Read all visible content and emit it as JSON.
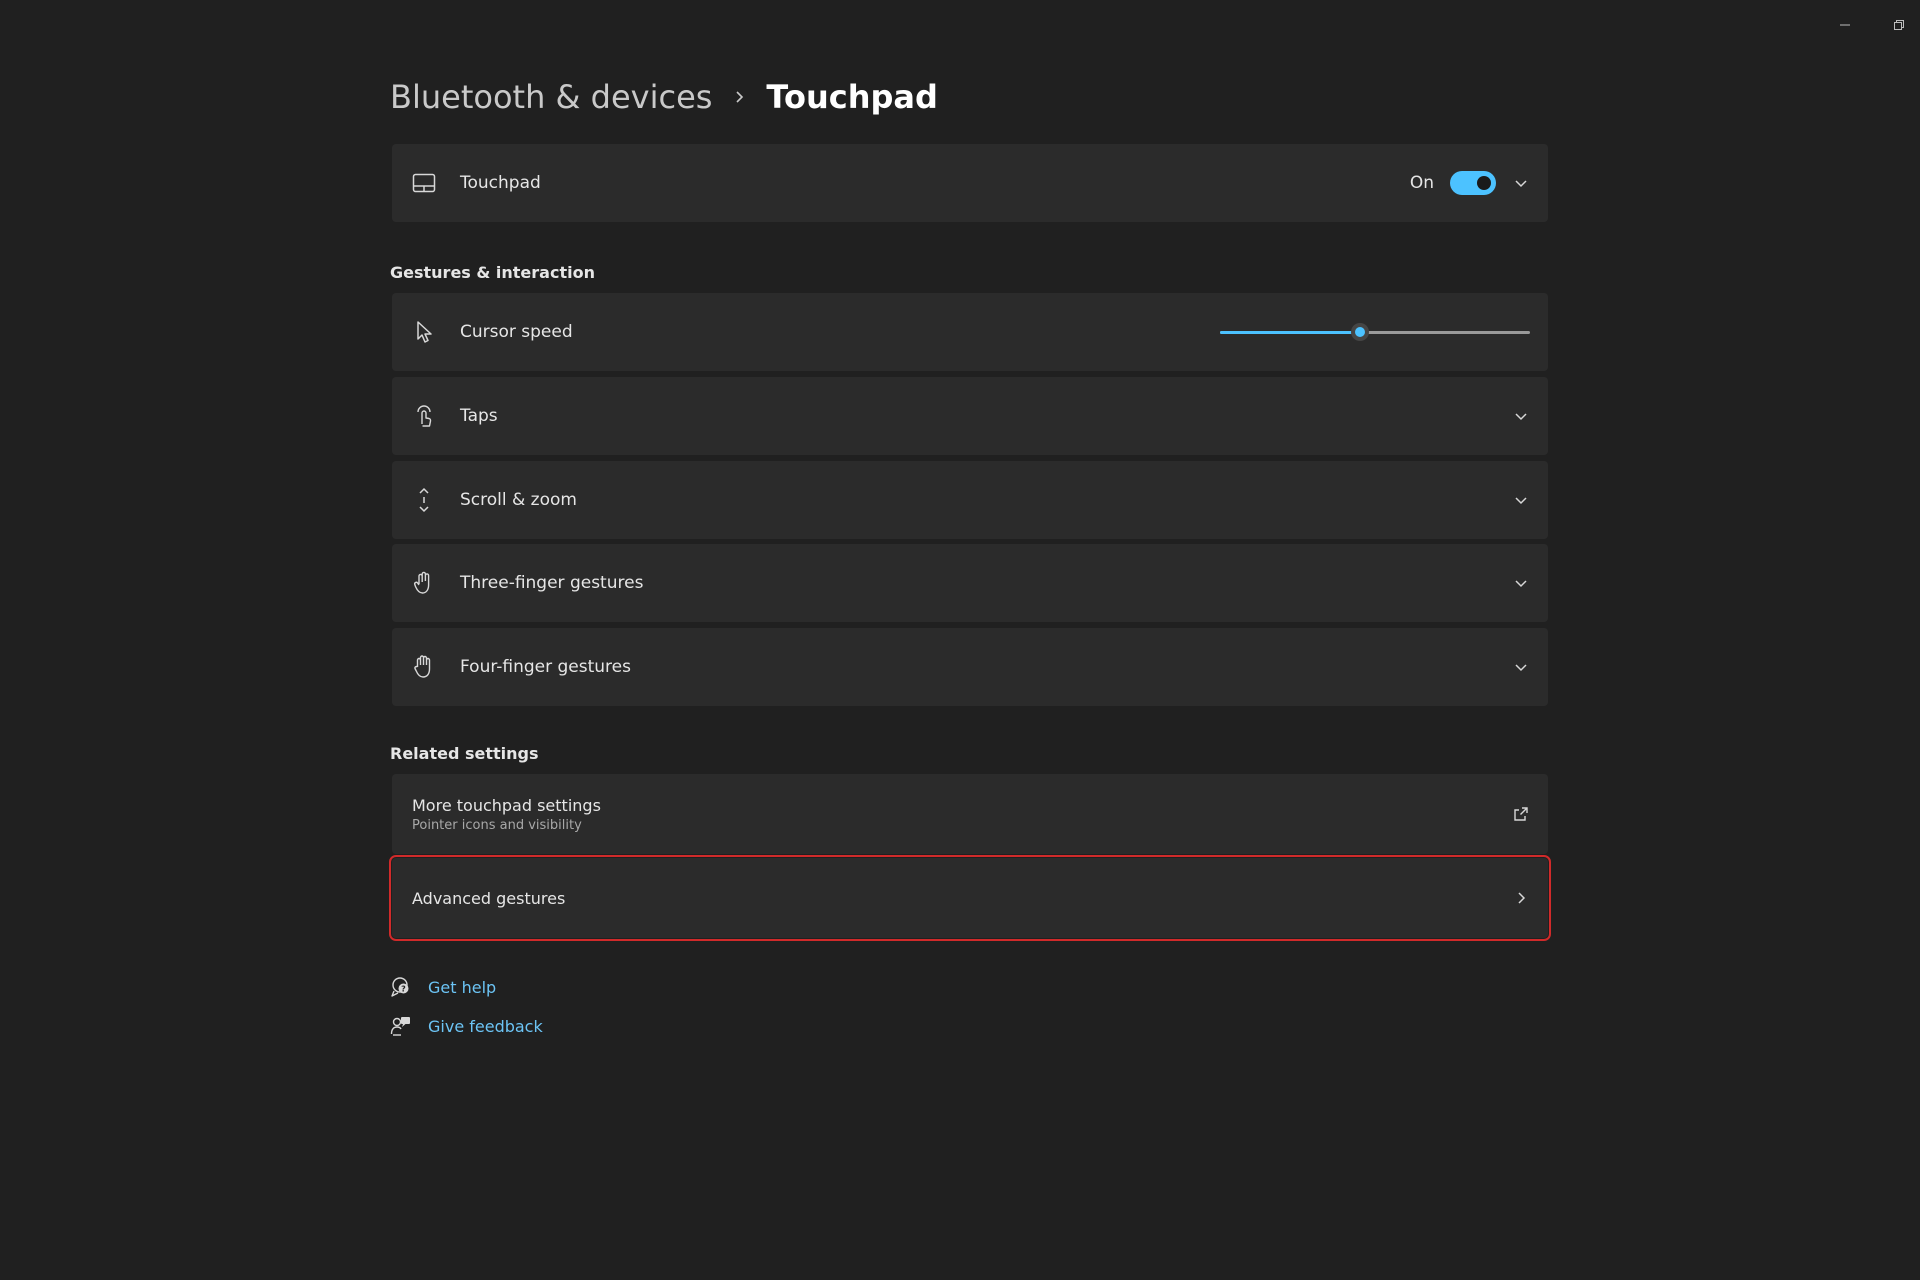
{
  "breadcrumb": {
    "parent": "Bluetooth & devices",
    "current": "Touchpad"
  },
  "touchpad_card": {
    "label": "Touchpad",
    "toggle_state": "On",
    "toggle_on": true
  },
  "gestures_section": {
    "title": "Gestures & interaction",
    "items": [
      {
        "label": "Cursor speed",
        "icon": "cursor-icon",
        "control": "slider",
        "value_fraction": 0.45
      },
      {
        "label": "Taps",
        "icon": "tap-icon"
      },
      {
        "label": "Scroll & zoom",
        "icon": "scroll-icon"
      },
      {
        "label": "Three-finger gestures",
        "icon": "hand-icon"
      },
      {
        "label": "Four-finger gestures",
        "icon": "hand-icon"
      }
    ]
  },
  "related_section": {
    "title": "Related settings",
    "more": {
      "label": "More touchpad settings",
      "sublabel": "Pointer icons and visibility",
      "icon": "external-link-icon"
    },
    "advanced": {
      "label": "Advanced gestures",
      "icon": "chevron-right-icon",
      "highlight_color": "#d12a2a"
    }
  },
  "footer": {
    "get_help": "Get help",
    "give_feedback": "Give feedback"
  },
  "colors": {
    "background": "#202020",
    "card": "#2b2b2b",
    "accent": "#4cc2ff",
    "link": "#6cc4f5"
  }
}
